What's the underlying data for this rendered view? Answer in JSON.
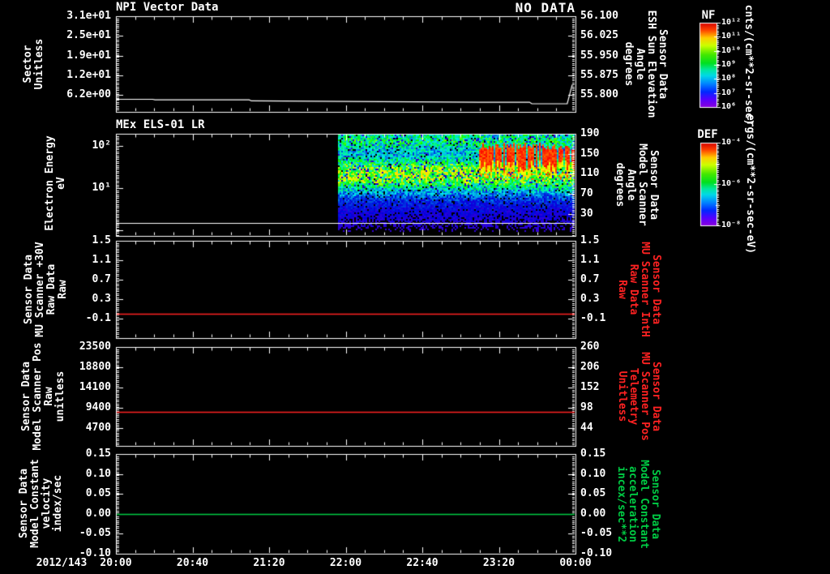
{
  "meta": {
    "colors": {
      "background": "#000000",
      "axis": "#ffffff",
      "red_series": "#ff2222",
      "green_series": "#00cc44"
    }
  },
  "xaxis": {
    "date_label": "2012/143",
    "ticks": [
      "20:00",
      "20:40",
      "21:20",
      "22:00",
      "22:40",
      "23:20",
      "00:00"
    ]
  },
  "panels": [
    {
      "id": "npi",
      "title": "NPI Vector Data",
      "status": "NO DATA",
      "left_axis": {
        "label": "Sector\nUnitless",
        "ticks": [
          "3.1e+01",
          "2.5e+01",
          "1.9e+01",
          "1.2e+01",
          "6.2e+00"
        ]
      },
      "right_axis": {
        "label": "Sensor Data\nESH Sun Elevation\nAngle\ndegrees",
        "ticks": [
          "56.100",
          "56.025",
          "55.950",
          "55.875",
          "55.800"
        ],
        "color": "#ffffff"
      }
    },
    {
      "id": "els",
      "title": "MEx ELS-01 LR",
      "left_axis": {
        "label": "Electron Energy\neV",
        "ticks": [
          "10²",
          "10¹"
        ]
      },
      "right_axis": {
        "label": "Sensor Data\nModel Scanner\nAngle\ndegrees",
        "ticks": [
          "190",
          "150",
          "110",
          "70",
          "30"
        ],
        "color": "#ffffff"
      }
    },
    {
      "id": "mu30v",
      "left_axis": {
        "label": "Sensor Data\nMU Scanner +30V\nRaw Data\nRaw",
        "ticks": [
          "1.5",
          "1.1",
          "0.7",
          "0.3",
          "-0.1"
        ]
      },
      "right_axis": {
        "label": "Sensor Data\nMU Scanner IntH\nRaw Data\nRaw",
        "ticks": [
          "1.5",
          "1.1",
          "0.7",
          "0.3",
          "-0.1"
        ],
        "color": "#ff2222"
      }
    },
    {
      "id": "scanpos",
      "left_axis": {
        "label": "Sensor Data\nModel Scanner Pos\nRaw\nunitless",
        "ticks": [
          "23500",
          "18800",
          "14100",
          "9400",
          "4700"
        ]
      },
      "right_axis": {
        "label": "Sensor Data\nMU Scanner Pos\nTelemetry\nUnitless",
        "ticks": [
          "260",
          "206",
          "152",
          "98",
          "44"
        ],
        "color": "#ff2222"
      }
    },
    {
      "id": "velocity",
      "left_axis": {
        "label": "Sensor Data\nModel Constant\nvelocity\nindex/sec",
        "ticks": [
          "0.15",
          "0.10",
          "0.05",
          "0.00",
          "-0.05",
          "-0.10"
        ]
      },
      "right_axis": {
        "label": "Sensor Data\nModel Constant\nacceleration\nincex/sec**2",
        "ticks": [
          "0.15",
          "0.10",
          "0.05",
          "0.00",
          "-0.05",
          "-0.10"
        ],
        "color": "#00cc44"
      }
    }
  ],
  "colorbars": [
    {
      "name": "NF",
      "unit": "cnts/(cm**2-sr-sec)",
      "ticks": [
        "10¹²",
        "10¹¹",
        "10¹⁰",
        "10⁹",
        "10⁸",
        "10⁷",
        "10⁶"
      ]
    },
    {
      "name": "DEF",
      "unit": "ergs/(cm**2-sr-sec-eV)",
      "ticks": [
        "10⁻⁴",
        "10⁻⁶",
        "10⁻⁸"
      ]
    }
  ],
  "chart_data": [
    {
      "type": "line",
      "title": "NPI Vector Data",
      "status": "NO DATA",
      "x_domain": [
        "2012/143 20:00",
        "2012/144 00:00"
      ],
      "ylabel_left": "Sector Unitless (3.1e+01 .. 6.2e+00 ticks, no data plotted)",
      "ylabel_right": "Sensor Data ESH Sun Elevation Angle degrees",
      "y_right_ticks": [
        56.1,
        56.025,
        55.95,
        55.875,
        55.8
      ],
      "series": [
        {
          "name": "ESH Sun Elevation Angle (degrees)",
          "color": "#ffffff",
          "points_frac_value": [
            [
              0.0,
              55.783
            ],
            [
              0.08,
              55.783
            ],
            [
              0.085,
              55.781
            ],
            [
              0.29,
              55.781
            ],
            [
              0.295,
              55.777
            ],
            [
              0.79,
              55.772
            ],
            [
              0.9,
              55.772
            ],
            [
              0.905,
              55.766
            ],
            [
              0.982,
              55.766
            ],
            [
              0.993,
              55.839
            ]
          ]
        }
      ]
    },
    {
      "type": "heatmap",
      "title": "MEx ELS-01 LR",
      "xlabel": "time 2012/143 20:00 - 00:00",
      "ylabel": "Electron Energy eV (log scale, ~0.8 to ~200 eV)",
      "y_ticks": [
        "10²",
        "10¹"
      ],
      "colorbar": "DEF",
      "intensity_units": "ergs/(cm**2-sr-sec-eV)",
      "intensity_range": [
        "1e-8",
        "1e-4"
      ],
      "data_start_frac": 0.483,
      "red_burst_start_frac": 0.757,
      "features": [
        "black (no data) before ~21:56",
        "continuous yellow-green band ~8-40 eV (~1e-6) from ~21:56 to 00:00",
        "intense red bursts ~30-120 eV (~1e-4) from ~23:05 to 00:00",
        "sparse blue/violet low flux (~1e-8) below ~5 eV",
        "thin white line across panel near ~1.4 eV"
      ]
    },
    {
      "type": "line",
      "ylabel_left": "Sensor Data MU Scanner +30V Raw Data Raw",
      "ylabel_right": "Sensor Data MU Scanner IntH Raw Data Raw",
      "y_ticks": [
        1.5,
        1.1,
        0.7,
        0.3,
        -0.1
      ],
      "series": [
        {
          "name": "MU Scanner +30V Raw",
          "color": "#ff2222",
          "value": 0.0,
          "shape": "constant"
        }
      ]
    },
    {
      "type": "line",
      "ylabel_left": "Sensor Data Model Scanner Pos Raw unitless",
      "ylabel_right": "Sensor Data MU Scanner Pos Telemetry Unitless",
      "y_ticks_left": [
        23500,
        18800,
        14100,
        9400,
        4700
      ],
      "y_ticks_right": [
        260,
        206,
        152,
        98,
        44
      ],
      "series": [
        {
          "name": "Model Scanner Pos Raw",
          "color": "#ff2222",
          "value": 8460,
          "shape": "constant"
        }
      ]
    },
    {
      "type": "line",
      "ylabel_left": "Sensor Data Model Constant velocity index/sec",
      "ylabel_right": "Sensor Data Model Constant acceleration incex/sec**2",
      "y_ticks": [
        0.15,
        0.1,
        0.05,
        0.0,
        -0.05,
        -0.1
      ],
      "series": [
        {
          "name": "Model Constant velocity",
          "color": "#00cc44",
          "value": 0.0,
          "shape": "constant"
        }
      ]
    }
  ]
}
